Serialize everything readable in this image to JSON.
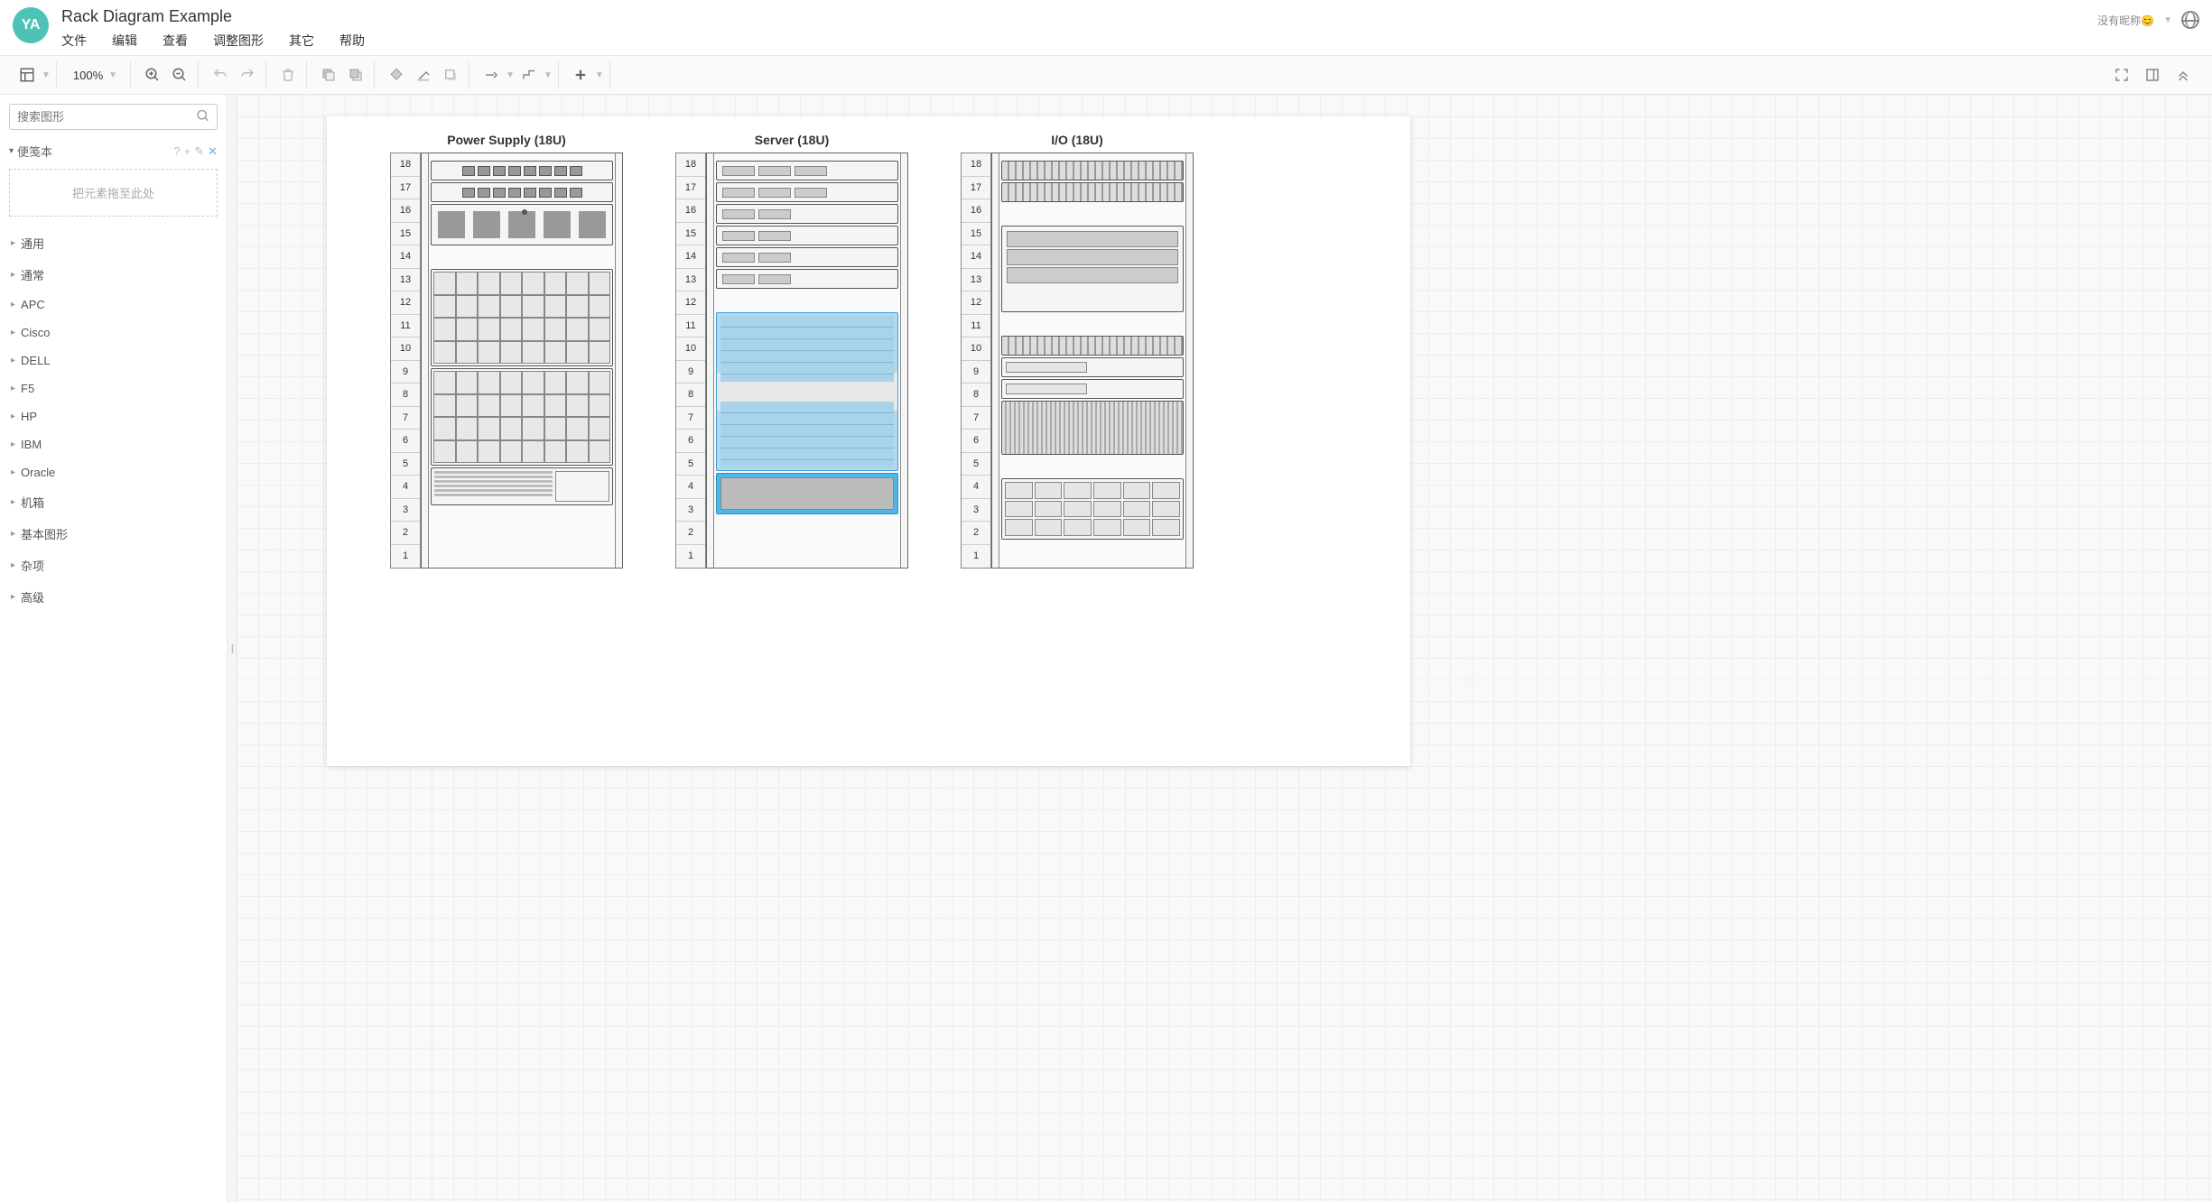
{
  "avatar": "YA",
  "doc_title": "Rack Diagram Example",
  "menu": {
    "file": "文件",
    "edit": "编辑",
    "view": "查看",
    "arrange": "调整图形",
    "other": "其它",
    "help": "帮助"
  },
  "user_label": "没有昵称😊",
  "zoom": "100%",
  "search_placeholder": "搜索图形",
  "scratchpad": {
    "title": "便笺本",
    "hint": "把元素拖至此处"
  },
  "shape_categories": [
    "通用",
    "通常",
    "APC",
    "Cisco",
    "DELL",
    "F5",
    "HP",
    "IBM",
    "Oracle",
    "机箱",
    "基本图形",
    "杂项",
    "高级"
  ],
  "racks": [
    {
      "title": "Power Supply (18U)",
      "units": 18
    },
    {
      "title": "Server (18U)",
      "units": 18
    },
    {
      "title": "I/O (18U)",
      "units": 18
    }
  ]
}
